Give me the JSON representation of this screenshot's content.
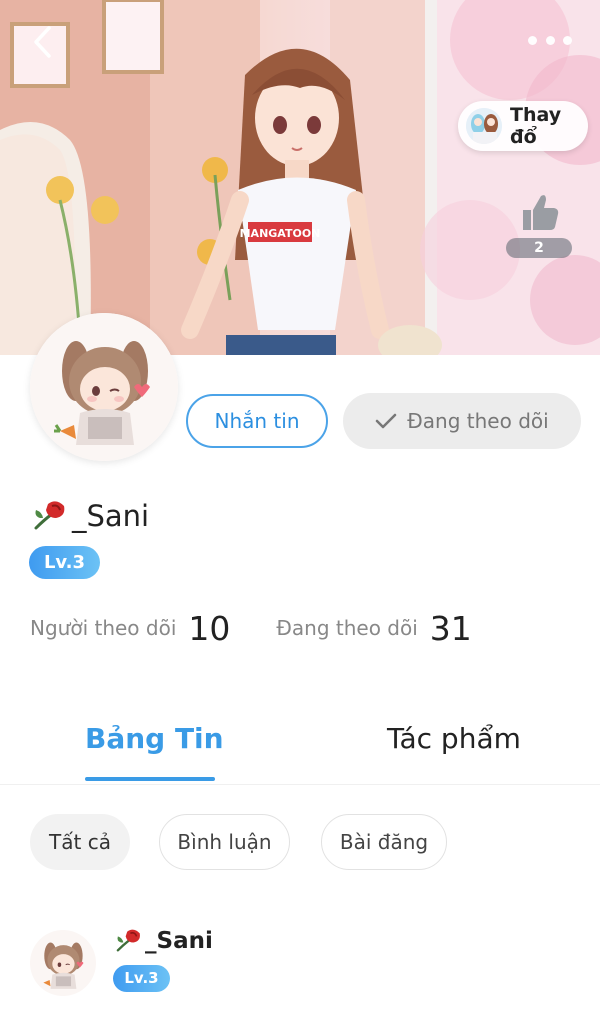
{
  "header": {
    "back_icon": "chevron-left-icon",
    "more_icon": "more-dots-icon",
    "change_outfit_label": "Thay đổ",
    "like_count": "2",
    "shirt_text": "MANGATOON"
  },
  "profile": {
    "username": "_Sani",
    "name_emoji": "rose-icon",
    "level": "Lv.3",
    "message_label": "Nhắn tin",
    "following_label": "Đang theo dõi",
    "followers_label": "Người theo dõi",
    "followers_count": "10",
    "following_count_label": "Đang theo dõi",
    "following_count": "31"
  },
  "tabs": {
    "feed": "Bảng Tin",
    "works": "Tác phẩm"
  },
  "filters": [
    "Tất cả",
    "Bình luận",
    "Bài đăng"
  ],
  "post": {
    "author": "_Sani",
    "level": "Lv.3"
  },
  "colors": {
    "accent": "#3a9be6",
    "level_badge": "#4aa8f0",
    "follow_bg": "#ececec"
  }
}
